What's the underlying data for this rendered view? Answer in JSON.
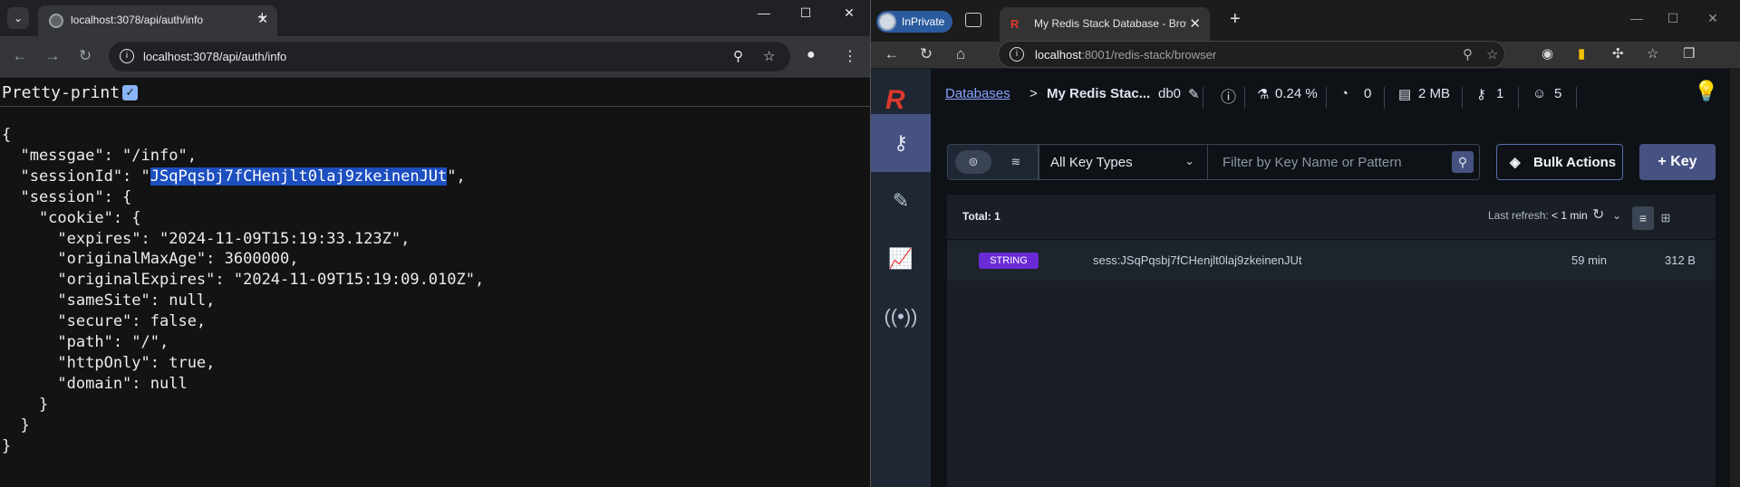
{
  "left": {
    "tab_title": "localhost:3078/api/auth/info",
    "url": "localhost:3078/api/auth/info",
    "pretty_print_label": "Pretty-print",
    "pretty_print_checked": true,
    "json_lines": {
      "l1": "{",
      "l2": "  \"messgae\": \"/info\",",
      "l3_pre": "  \"sessionId\": \"",
      "l3_sel": "JSqPqsbj7fCHenjlt0laj9zkeinenJUt",
      "l3_post": "\",",
      "l4": "  \"session\": {",
      "l5": "    \"cookie\": {",
      "l6": "      \"expires\": \"2024-11-09T15:19:33.123Z\",",
      "l7": "      \"originalMaxAge\": 3600000,",
      "l8": "      \"originalExpires\": \"2024-11-09T15:19:09.010Z\",",
      "l9": "      \"sameSite\": null,",
      "l10": "      \"secure\": false,",
      "l11": "      \"path\": \"/\",",
      "l12": "      \"httpOnly\": true,",
      "l13": "      \"domain\": null",
      "l14": "    }",
      "l15": "  }",
      "l16": "}"
    }
  },
  "right": {
    "inprivate_label": "InPrivate",
    "tab_title": "My Redis Stack Database - Browser",
    "url_host": "localhost",
    "url_rest": ":8001/redis-stack/browser",
    "app": {
      "breadcrumb_link": "Databases",
      "breadcrumb_sep": ">",
      "db_name": "My Redis Stac...",
      "db_index": "db0",
      "cpu": "0.24 %",
      "ops": "0",
      "memory": "2 MB",
      "keys": "1",
      "clients": "5",
      "key_type_select": "All Key Types",
      "search_placeholder": "Filter by Key Name or Pattern",
      "bulk_actions_label": "Bulk Actions",
      "add_key_label": "+ Key",
      "total_label": "Total: 1",
      "last_refresh_label": "Last refresh:",
      "last_refresh_value": "< 1 min",
      "rows": [
        {
          "type": "STRING",
          "key": "sess:JSqPqsbj7fCHenjlt0laj9zkeinenJUt",
          "ttl": "59 min",
          "size": "312 B"
        }
      ]
    }
  },
  "colors": {
    "selection": "#1d4fbf",
    "redis_red": "#dc382c",
    "string_badge": "#6a2bd6",
    "primary": "#465282"
  }
}
